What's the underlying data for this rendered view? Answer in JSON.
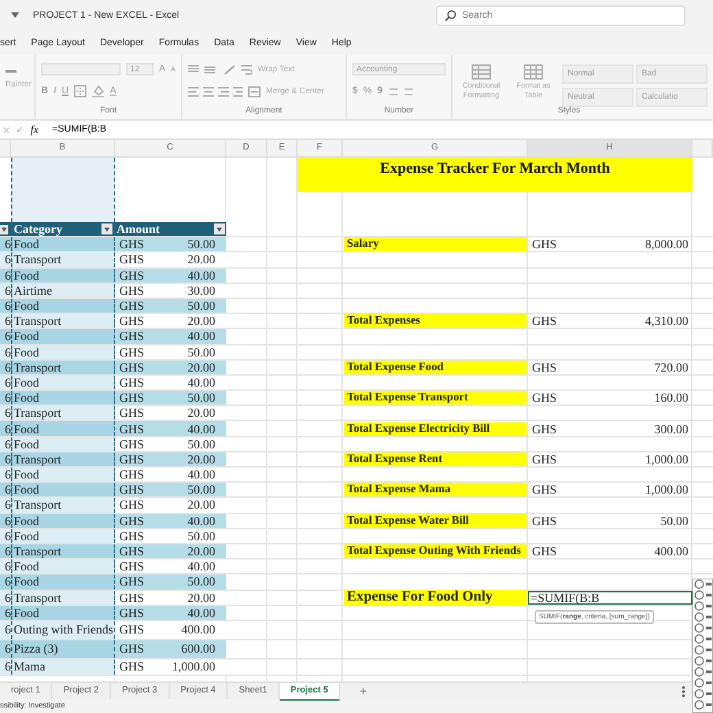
{
  "window": {
    "title": "PROJECT 1 - New EXCEL - Excel",
    "search_placeholder": "Search"
  },
  "ribbon_tabs": [
    "sert",
    "Page Layout",
    "Developer",
    "Formulas",
    "Data",
    "Review",
    "View",
    "Help"
  ],
  "ribbon": {
    "painter": "Painter",
    "font": {
      "size": "12",
      "grow": "A",
      "shrink": "A",
      "bold": "B",
      "italic": "I",
      "underline": "U",
      "color_letter": "A",
      "label": "Font"
    },
    "alignment": {
      "wrap": "Wrap Text",
      "merge": "Merge & Center",
      "label": "Alignment"
    },
    "number": {
      "format": "Accounting",
      "currency": "$",
      "percent": "%",
      "comma": "9",
      "label": "Number"
    },
    "styles": {
      "conditional": "Conditional Formatting",
      "format_table": "Format as Table",
      "gallery": [
        "Normal",
        "Bad",
        "Neutral",
        "Calculatio"
      ],
      "label": "Styles"
    }
  },
  "formula_bar": {
    "cancel": "×",
    "enter": "✓",
    "fx": "fx",
    "formula": "=SUMIF(B:B"
  },
  "columns": [
    "B",
    "C",
    "D",
    "E",
    "F",
    "G",
    "H"
  ],
  "table": {
    "header": [
      "Category",
      "Amount"
    ],
    "rows": [
      {
        "column_1": "6",
        "category": "Food",
        "currency": "GHS",
        "amount": "50.00"
      },
      {
        "column_1": "6",
        "category": "Transport",
        "currency": "GHS",
        "amount": "20.00"
      },
      {
        "column_1": "6",
        "category": "Food",
        "currency": "GHS",
        "amount": "40.00"
      },
      {
        "column_1": "6",
        "category": "Airtime",
        "currency": "GHS",
        "amount": "30.00"
      },
      {
        "column_1": "6",
        "category": "Food",
        "currency": "GHS",
        "amount": "50.00"
      },
      {
        "column_1": "6",
        "category": "Transport",
        "currency": "GHS",
        "amount": "20.00"
      },
      {
        "column_1": "6",
        "category": "Food",
        "currency": "GHS",
        "amount": "40.00"
      },
      {
        "column_1": "6",
        "category": "Food",
        "currency": "GHS",
        "amount": "50.00"
      },
      {
        "column_1": "6",
        "category": "Transport",
        "currency": "GHS",
        "amount": "20.00"
      },
      {
        "column_1": "6",
        "category": "Food",
        "currency": "GHS",
        "amount": "40.00"
      },
      {
        "column_1": "6",
        "category": "Food",
        "currency": "GHS",
        "amount": "50.00"
      },
      {
        "column_1": "6",
        "category": "Transport",
        "currency": "GHS",
        "amount": "20.00"
      },
      {
        "column_1": "6",
        "category": "Food",
        "currency": "GHS",
        "amount": "40.00"
      },
      {
        "column_1": "6",
        "category": "Food",
        "currency": "GHS",
        "amount": "50.00"
      },
      {
        "column_1": "6",
        "category": "Transport",
        "currency": "GHS",
        "amount": "20.00"
      },
      {
        "column_1": "6",
        "category": "Food",
        "currency": "GHS",
        "amount": "40.00"
      },
      {
        "column_1": "6",
        "category": "Food",
        "currency": "GHS",
        "amount": "50.00"
      },
      {
        "column_1": "6",
        "category": "Transport",
        "currency": "GHS",
        "amount": "20.00"
      },
      {
        "column_1": "6",
        "category": "Food",
        "currency": "GHS",
        "amount": "40.00"
      },
      {
        "column_1": "6",
        "category": "Food",
        "currency": "GHS",
        "amount": "50.00"
      },
      {
        "column_1": "6",
        "category": "Transport",
        "currency": "GHS",
        "amount": "20.00"
      },
      {
        "column_1": "6",
        "category": "Food",
        "currency": "GHS",
        "amount": "40.00"
      },
      {
        "column_1": "6",
        "category": "Food",
        "currency": "GHS",
        "amount": "50.00"
      },
      {
        "column_1": "6",
        "category": "Transport",
        "currency": "GHS",
        "amount": "20.00"
      },
      {
        "column_1": "6",
        "category": "Food",
        "currency": "GHS",
        "amount": "40.00"
      },
      {
        "column_1": "6",
        "category": "Outing with Friends",
        "currency": "GHS",
        "amount": "400.00"
      },
      {
        "column_1": "6",
        "category": "Pizza (3)",
        "currency": "GHS",
        "amount": "600.00"
      },
      {
        "column_1": "6",
        "category": "Mama",
        "currency": "GHS",
        "amount": "1,000.00"
      }
    ]
  },
  "summary": {
    "title": "Expense Tracker For March Month",
    "items": [
      {
        "label": "Salary",
        "currency": "GHS",
        "amount": "8,000.00"
      },
      {
        "label": "Total Expenses",
        "currency": "GHS",
        "amount": "4,310.00"
      },
      {
        "label": "Total Expense Food",
        "currency": "GHS",
        "amount": "720.00"
      },
      {
        "label": "Total Expense Transport",
        "currency": "GHS",
        "amount": "160.00"
      },
      {
        "label": "Total Expense Electricity Bill",
        "currency": "GHS",
        "amount": "300.00"
      },
      {
        "label": "Total Expense Rent",
        "currency": "GHS",
        "amount": "1,000.00"
      },
      {
        "label": "Total Expense Mama",
        "currency": "GHS",
        "amount": "1,000.00"
      },
      {
        "label": "Total Expense Water Bill",
        "currency": "GHS",
        "amount": "50.00"
      },
      {
        "label": "Total Expense Outing With Friends",
        "currency": "GHS",
        "amount": "400.00"
      }
    ],
    "query": {
      "label": "Expense For Food Only",
      "formula": "=SUMIF(B:B",
      "tooltip": "SUMIF(**range**, criteria, [sum_range])"
    }
  },
  "sheet_tabs": [
    {
      "label": "roject 1",
      "selected": false
    },
    {
      "label": "Project 2",
      "selected": false
    },
    {
      "label": "Project 3",
      "selected": false
    },
    {
      "label": "Project 4",
      "selected": false
    },
    {
      "label": "Sheet1",
      "selected": false
    },
    {
      "label": "Project 5",
      "selected": true
    }
  ],
  "add_sheet": "+",
  "status_bar": "ssibility: Investigate"
}
